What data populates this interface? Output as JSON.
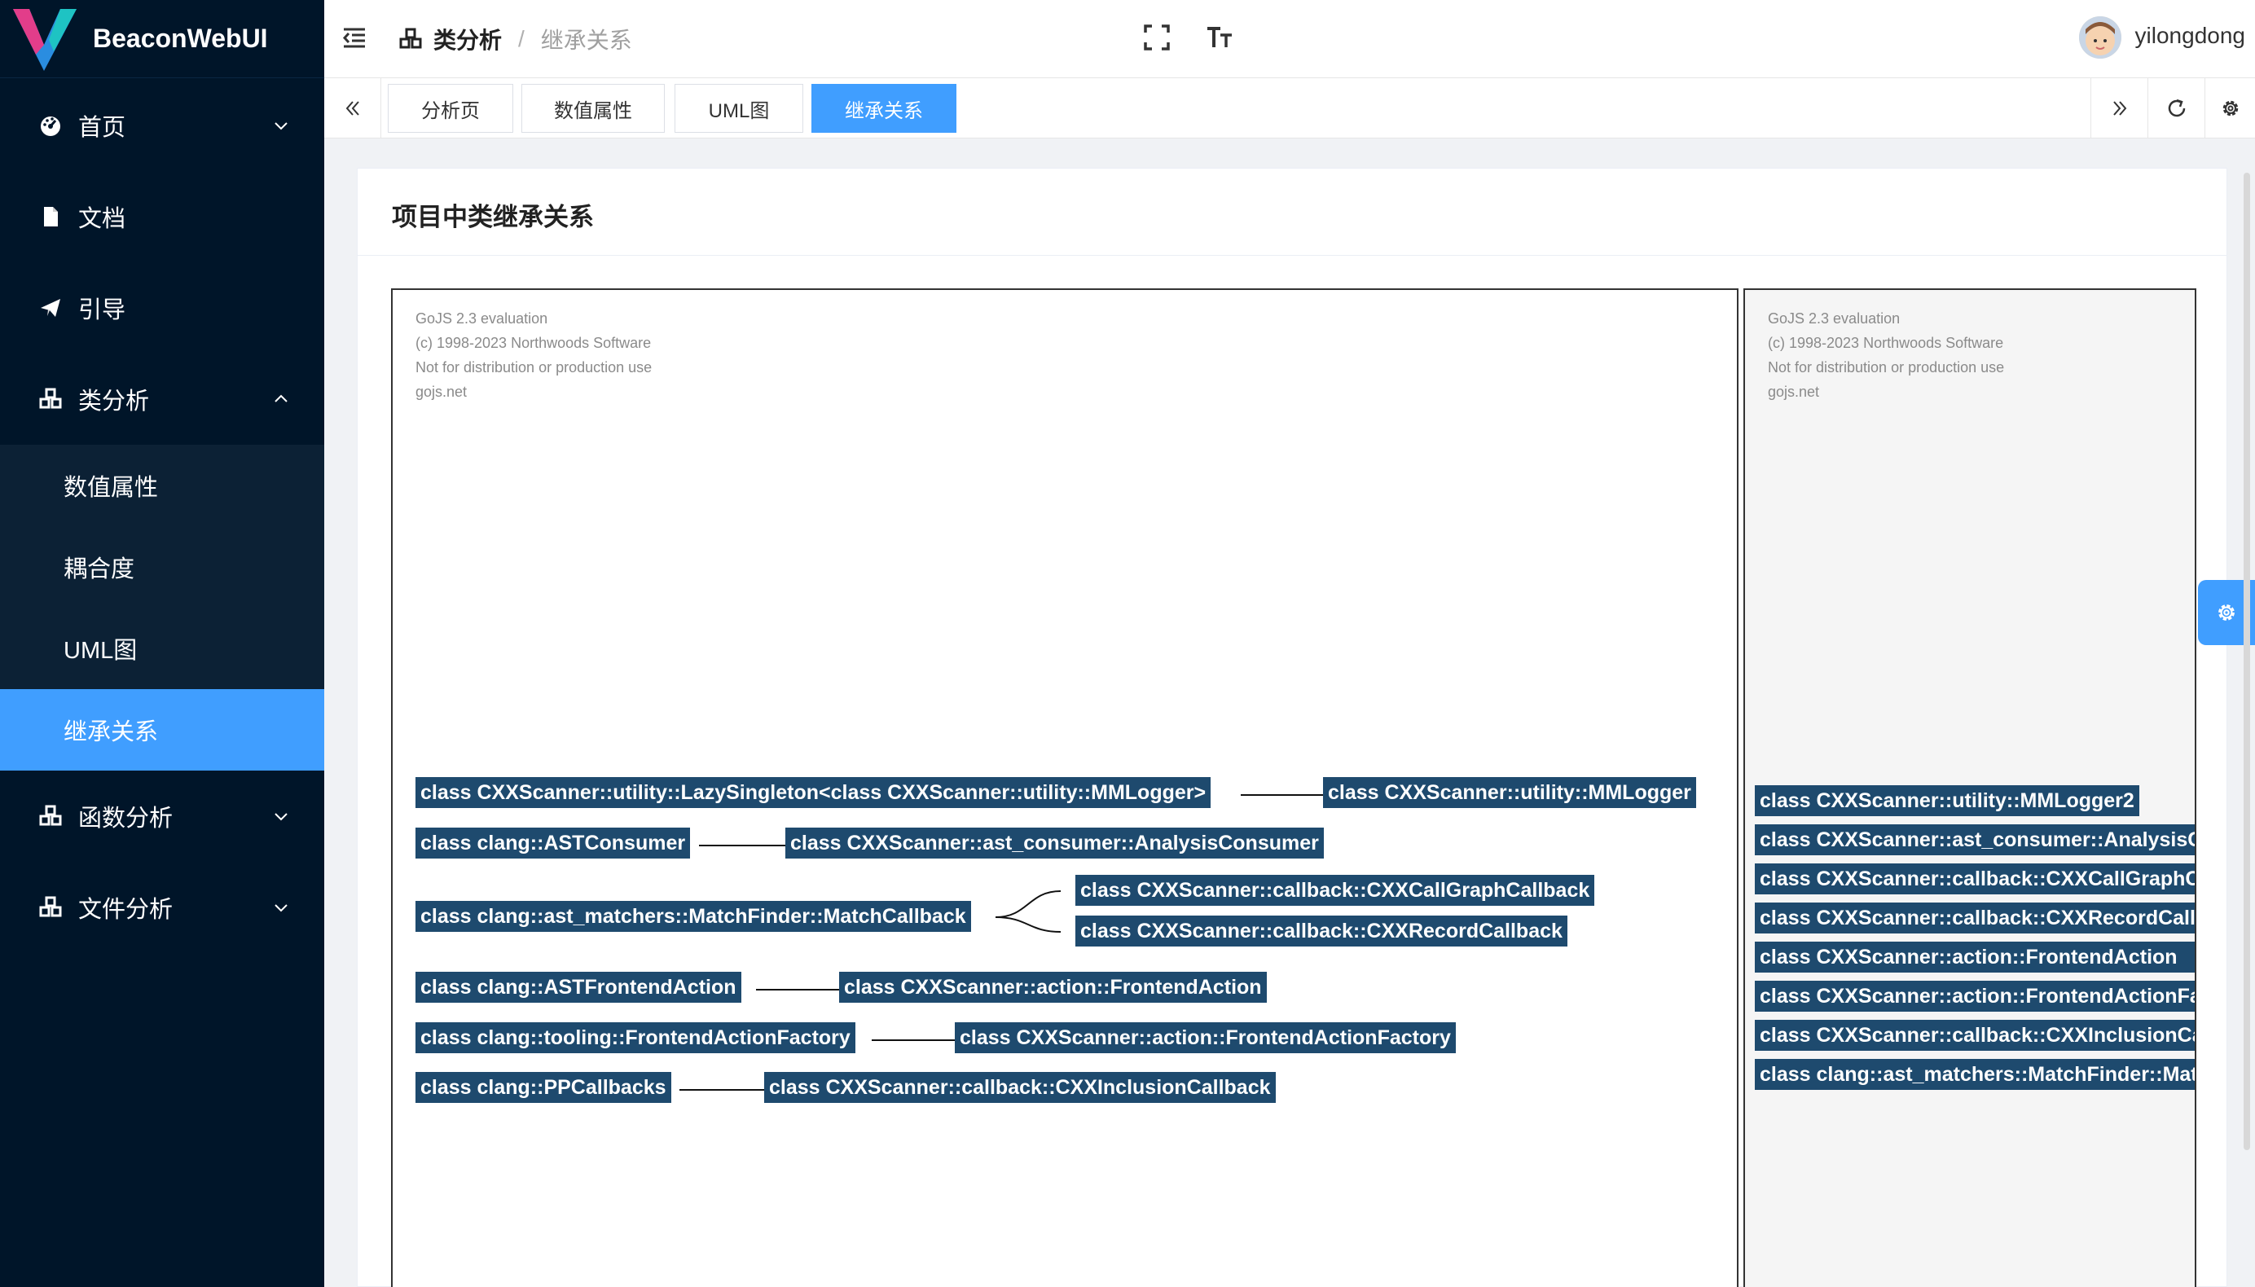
{
  "app": {
    "brand": "BeaconWebUI"
  },
  "sidebar": {
    "items": [
      {
        "label": "首页",
        "icon": "dashboard-icon",
        "expandable": true,
        "expanded": false
      },
      {
        "label": "文档",
        "icon": "document-icon",
        "expandable": false
      },
      {
        "label": "引导",
        "icon": "send-icon",
        "expandable": false
      },
      {
        "label": "类分析",
        "icon": "cubes-icon",
        "expandable": true,
        "expanded": true
      },
      {
        "label": "函数分析",
        "icon": "cubes-icon",
        "expandable": true,
        "expanded": false
      },
      {
        "label": "文件分析",
        "icon": "cubes-icon",
        "expandable": true,
        "expanded": false
      }
    ],
    "submenu": [
      "数值属性",
      "耦合度",
      "UML图",
      "继承关系"
    ],
    "active_submenu": "继承关系"
  },
  "header": {
    "breadcrumb": [
      "类分析",
      "继承关系"
    ],
    "breadcrumb_separator": "/",
    "username": "yilongdong"
  },
  "tabs": {
    "items": [
      "分析页",
      "数值属性",
      "UML图",
      "继承关系"
    ],
    "active": "继承关系"
  },
  "card": {
    "title": "项目中类继承关系"
  },
  "watermark": {
    "lines": [
      "GoJS 2.3 evaluation",
      "(c) 1998-2023 Northwoods Software",
      "Not for distribution or production use",
      "gojs.net"
    ]
  },
  "diagram": {
    "nodes": {
      "n1": "class CXXScanner::utility::LazySingleton<class CXXScanner::utility::MMLogger>",
      "n2": "class CXXScanner::utility::MMLogger",
      "n3": "class clang::ASTConsumer",
      "n4": "class CXXScanner::ast_consumer::AnalysisConsumer",
      "n5": "class clang::ast_matchers::MatchFinder::MatchCallback",
      "n6": "class CXXScanner::callback::CXXCallGraphCallback",
      "n7": "class CXXScanner::callback::CXXRecordCallback",
      "n8": "class clang::ASTFrontendAction",
      "n9": "class CXXScanner::action::FrontendAction",
      "n10": "class clang::tooling::FrontendActionFactory",
      "n11": "class CXXScanner::action::FrontendActionFactory",
      "n12": "class clang::PPCallbacks",
      "n13": "class CXXScanner::callback::CXXInclusionCallback"
    },
    "overview_nodes": [
      "class CXXScanner::utility::MMLogger2",
      "class CXXScanner::ast_consumer::AnalysisConsumer",
      "class CXXScanner::callback::CXXCallGraphCallback",
      "class CXXScanner::callback::CXXRecordCallback",
      "class CXXScanner::action::FrontendAction",
      "class CXXScanner::action::FrontendActionFactory",
      "class CXXScanner::callback::CXXInclusionCallback",
      "class clang::ast_matchers::MatchFinder::MatchCallback"
    ]
  },
  "colors": {
    "sidebar_bg": "#001529",
    "accent": "#409eff",
    "node_bg": "#1e4a6e"
  }
}
